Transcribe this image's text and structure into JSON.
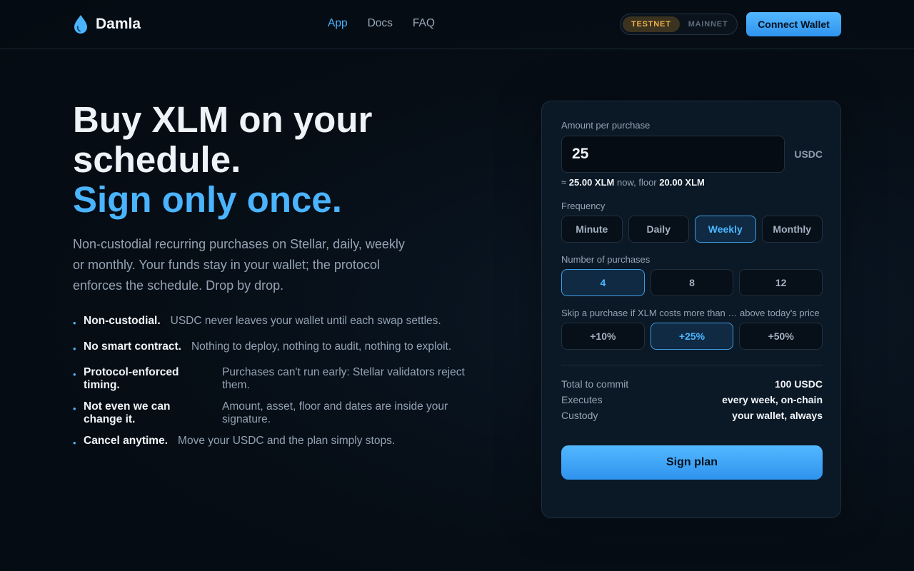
{
  "header": {
    "brand": "Damla",
    "brand_icon": "droplet-icon",
    "nav": [
      {
        "label": "App",
        "active": true
      },
      {
        "label": "Docs",
        "active": false
      },
      {
        "label": "FAQ",
        "active": false
      }
    ],
    "network": {
      "options": [
        "TESTNET",
        "MAINNET"
      ],
      "selected": "TESTNET"
    },
    "connect_label": "Connect Wallet"
  },
  "hero": {
    "title_line1": "Buy XLM on your",
    "title_line2": "schedule.",
    "title_accent": "Sign only once.",
    "description": "Non-custodial recurring purchases on Stellar, daily, weekly or monthly. Your funds stay in your wallet; the protocol enforces the schedule. Drop by drop.",
    "features": [
      {
        "title": "Non-custodial.",
        "text": "USDC never leaves your wallet until each swap settles."
      },
      {
        "title": "No smart contract.",
        "text": "Nothing to deploy, nothing to audit, nothing to exploit."
      },
      {
        "title": "Protocol-enforced timing.",
        "text": "Purchases can't run early: Stellar validators reject them."
      },
      {
        "title": "Not even we can change it.",
        "text": "Amount, asset, floor and dates are inside your signature."
      },
      {
        "title": "Cancel anytime.",
        "text": "Move your USDC and the plan simply stops."
      }
    ]
  },
  "form": {
    "amount_label": "Amount per purchase",
    "amount_value": "25",
    "amount_unit": "USDC",
    "quote_prefix": "≈",
    "quote_now": "25.00 XLM",
    "quote_mid": "now, floor",
    "quote_floor": "20.00 XLM",
    "frequency_label": "Frequency",
    "frequency_options": [
      "Minute",
      "Daily",
      "Weekly",
      "Monthly"
    ],
    "frequency_selected": "Weekly",
    "count_label": "Number of purchases",
    "count_options": [
      "4",
      "8",
      "12"
    ],
    "count_selected": "4",
    "skip_label": "Skip a purchase if XLM costs more than … above today's price",
    "skip_options": [
      "+10%",
      "+25%",
      "+50%"
    ],
    "skip_selected": "+25%",
    "summary": [
      {
        "key": "Total to commit",
        "value": "100 USDC"
      },
      {
        "key": "Executes",
        "value": "every week, on-chain"
      },
      {
        "key": "Custody",
        "value": "your wallet, always"
      }
    ],
    "sign_label": "Sign plan"
  },
  "colors": {
    "accent": "#4bb4ff",
    "background": "#060d15",
    "card": "#0b1825",
    "testnet": "#f0b34a"
  }
}
